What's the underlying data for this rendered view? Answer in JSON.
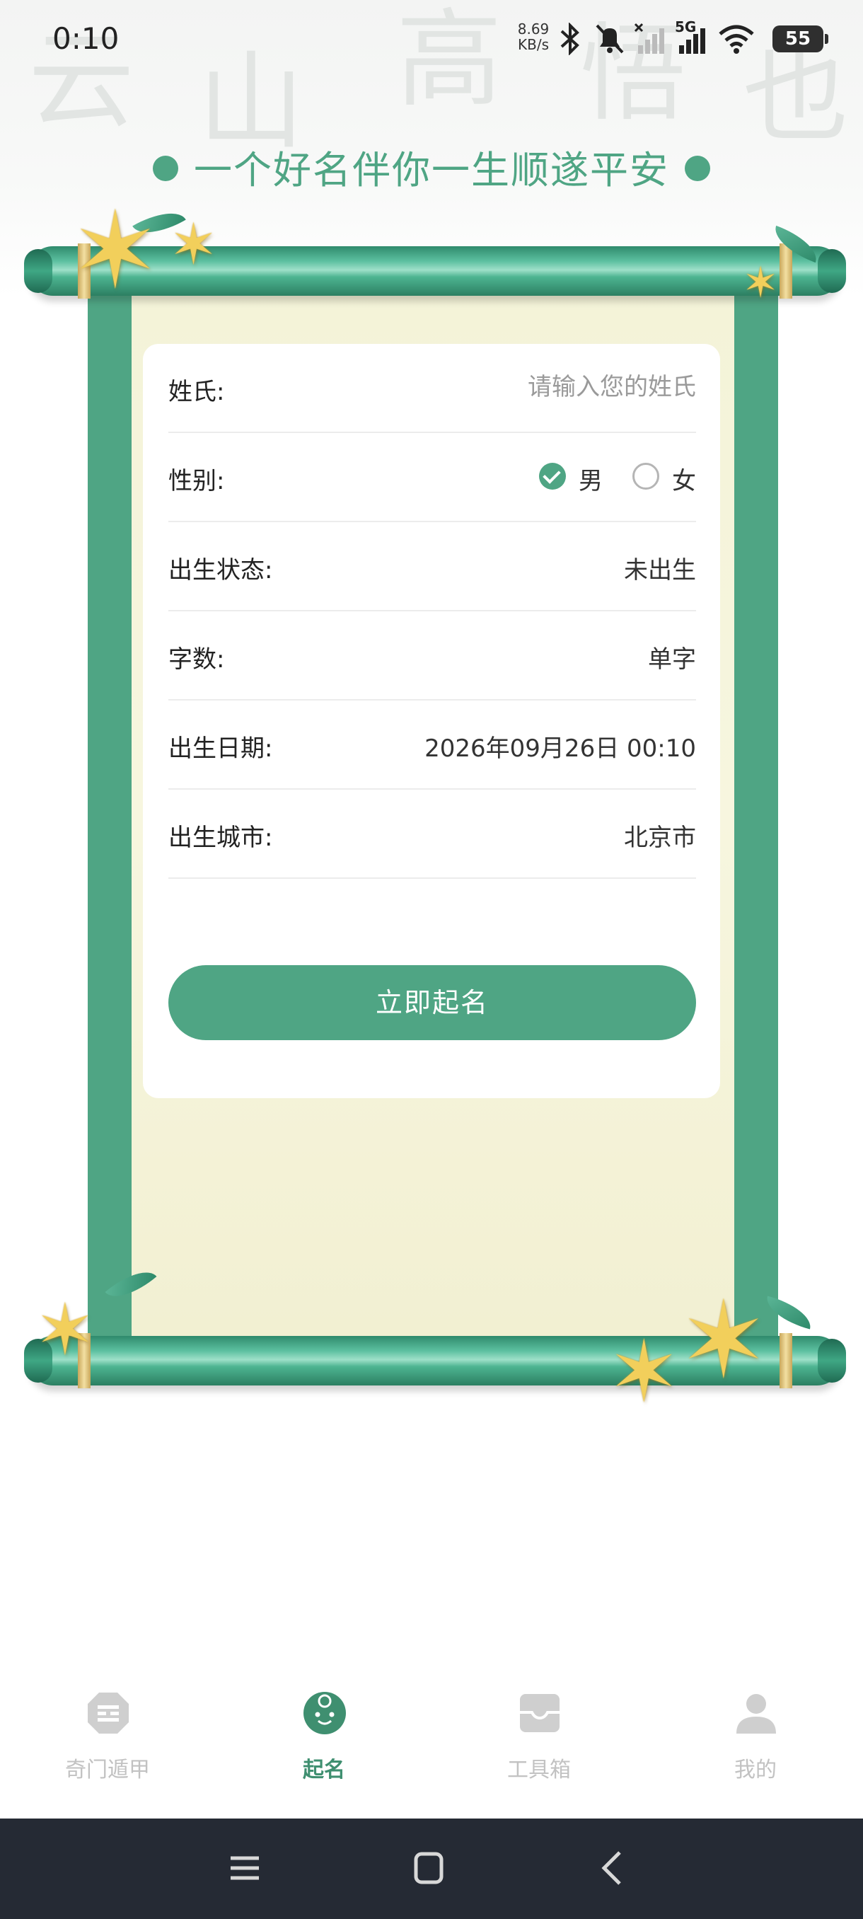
{
  "status_bar": {
    "time": "0:10",
    "net_speed_value": "8.69",
    "net_speed_unit": "KB/s",
    "network_type": "5G",
    "battery": "55"
  },
  "slogan": "一个好名伴你一生顺遂平安",
  "form": {
    "surname": {
      "label": "姓氏:",
      "value": "",
      "placeholder": "请输入您的姓氏"
    },
    "gender": {
      "label": "性别:",
      "options": [
        "男",
        "女"
      ],
      "selected": "男"
    },
    "birth_status": {
      "label": "出生状态:",
      "value": "未出生"
    },
    "char_count": {
      "label": "字数:",
      "value": "单字"
    },
    "birth_date": {
      "label": "出生日期:",
      "value": "2026年09月26日 00:10"
    },
    "birth_city": {
      "label": "出生城市:",
      "value": "北京市"
    },
    "submit_label": "立即起名"
  },
  "tabs": [
    {
      "label": "奇门遁甲",
      "icon": "qimen-icon",
      "active": false
    },
    {
      "label": "起名",
      "icon": "baby-face-icon",
      "active": true
    },
    {
      "label": "工具箱",
      "icon": "toolbox-icon",
      "active": false
    },
    {
      "label": "我的",
      "icon": "user-icon",
      "active": false
    }
  ],
  "colors": {
    "accent": "#4fa584",
    "paper": "#f5f4da",
    "nav_bar": "#252a34",
    "inactive_tab": "#c2c2c2"
  }
}
